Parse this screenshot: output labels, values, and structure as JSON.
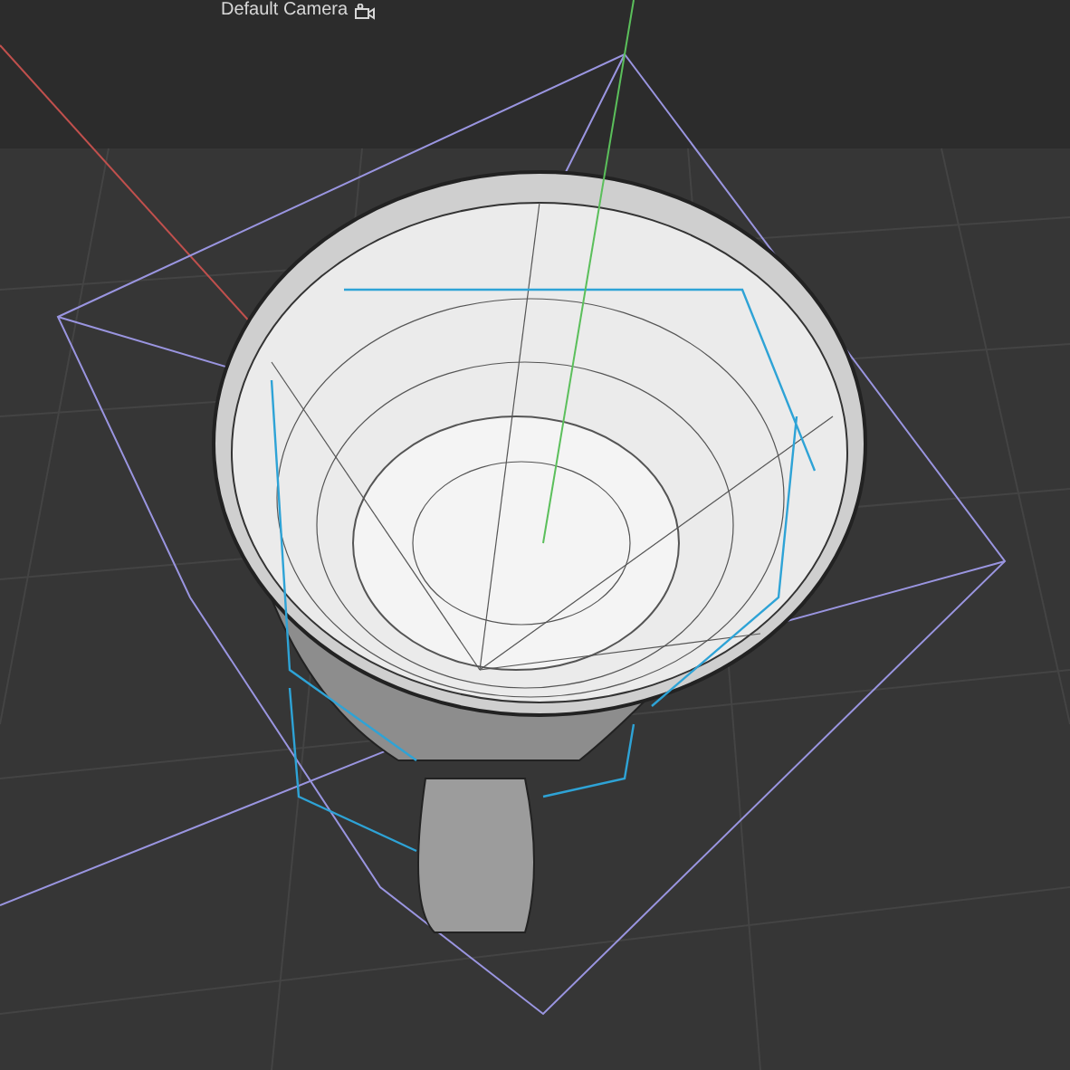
{
  "viewport": {
    "camera_label": "Default Camera"
  }
}
